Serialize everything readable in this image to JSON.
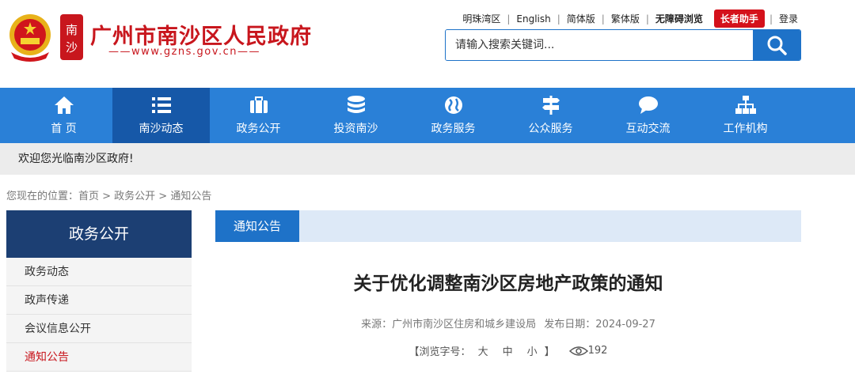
{
  "header": {
    "site_title": "广州市南沙区人民政府",
    "site_url": "——www.gzns.gov.cn——",
    "top_links": [
      {
        "label": "明珠湾区"
      },
      {
        "label": "English"
      },
      {
        "label": "简体版"
      },
      {
        "label": "繁体版"
      },
      {
        "label": "无障碍浏览"
      }
    ],
    "elder_button": "长者助手",
    "login": "登录",
    "search_placeholder": "请输入搜索关键词..."
  },
  "nav": {
    "items": [
      {
        "label": "首 页",
        "icon": "home-icon"
      },
      {
        "label": "南沙动态",
        "icon": "list-icon"
      },
      {
        "label": "政务公开",
        "icon": "briefcase-icon"
      },
      {
        "label": "投资南沙",
        "icon": "database-icon"
      },
      {
        "label": "政务服务",
        "icon": "globe-icon"
      },
      {
        "label": "公众服务",
        "icon": "signpost-icon"
      },
      {
        "label": "互动交流",
        "icon": "chat-icon"
      },
      {
        "label": "工作机构",
        "icon": "org-chart-icon"
      }
    ],
    "active_index": 1
  },
  "welcome_text": "欢迎您光临南沙区政府!",
  "breadcrumb": "您现在的位置：首页 > 政务公开 > 通知公告",
  "sidebar": {
    "title": "政务公开",
    "items": [
      {
        "label": "政务动态"
      },
      {
        "label": "政声传递"
      },
      {
        "label": "会议信息公开"
      },
      {
        "label": "通知公告"
      }
    ]
  },
  "content": {
    "tab": "通知公告",
    "title": "关于优化调整南沙区房地产政策的通知",
    "source": "来源：广州市南沙区住房和城乡建设局",
    "date": "发布日期：2024-09-27",
    "font_size_label": "【浏览字号：",
    "font_large": "大",
    "font_medium": "中",
    "font_small": "小",
    "font_close": "】",
    "views": "192"
  },
  "colors": {
    "brand_red": "#c8161d",
    "nav_blue": "#2a80d7",
    "nav_active": "#1658a8",
    "sidebar_head": "#1c3f73"
  }
}
